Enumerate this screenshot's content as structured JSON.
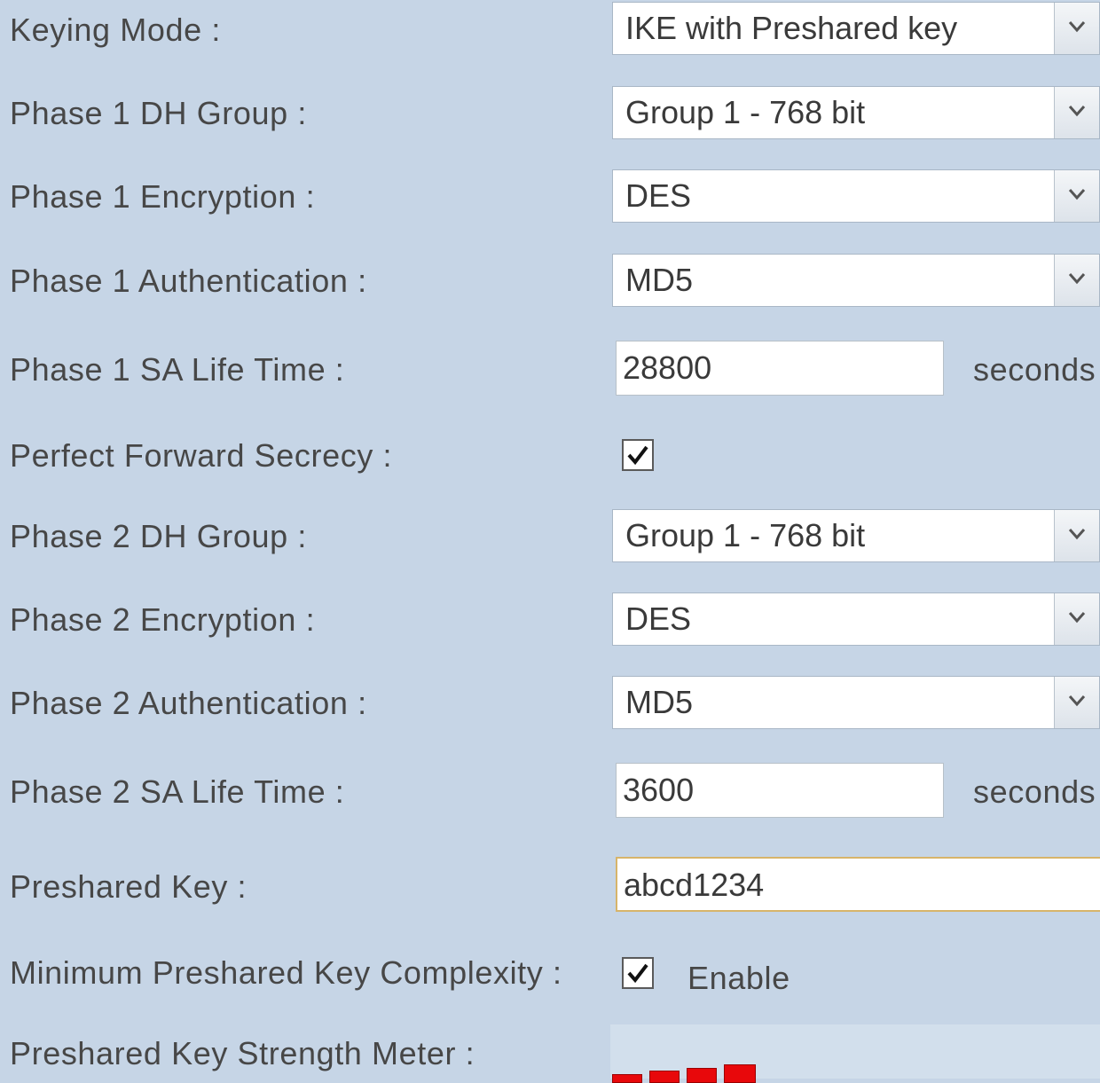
{
  "fields": {
    "keying_mode": {
      "label": "Keying Mode :",
      "value": "IKE with Preshared key"
    },
    "phase1_dh_group": {
      "label": "Phase 1 DH Group :",
      "value": "Group 1 - 768 bit"
    },
    "phase1_encryption": {
      "label": "Phase 1 Encryption :",
      "value": "DES"
    },
    "phase1_authentication": {
      "label": "Phase 1 Authentication :",
      "value": "MD5"
    },
    "phase1_sa_life_time": {
      "label": "Phase 1 SA Life Time :",
      "value": "28800",
      "unit": "seconds"
    },
    "perfect_forward_secrecy": {
      "label": "Perfect Forward Secrecy :",
      "checked": true
    },
    "phase2_dh_group": {
      "label": "Phase 2 DH Group :",
      "value": "Group 1 - 768 bit"
    },
    "phase2_encryption": {
      "label": "Phase 2 Encryption :",
      "value": "DES"
    },
    "phase2_authentication": {
      "label": "Phase 2 Authentication :",
      "value": "MD5"
    },
    "phase2_sa_life_time": {
      "label": "Phase 2 SA Life Time :",
      "value": "3600",
      "unit": "seconds"
    },
    "preshared_key": {
      "label": "Preshared Key :",
      "value": "abcd1234"
    },
    "min_key_complexity": {
      "label": "Minimum Preshared Key Complexity :",
      "checked": true,
      "option_label": "Enable"
    },
    "strength_meter": {
      "label": "Preshared Key Strength Meter :",
      "bars_visible": 4,
      "color": "#e8080b"
    }
  },
  "colors": {
    "background": "#c6d5e6",
    "meter": "#e8080b",
    "focus_border": "#d7b46a"
  },
  "icons": {
    "select_arrow": "chevron-down-icon",
    "check": "checkmark-icon"
  }
}
